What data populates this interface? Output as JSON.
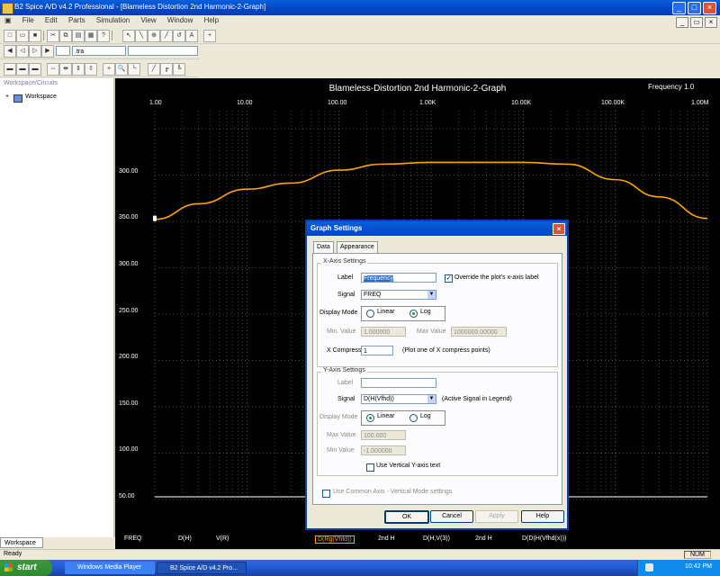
{
  "window": {
    "title": "B2 Spice A/D v4.2 Professional - [Blameless Distortion 2nd Harmonic-2-Graph]"
  },
  "menu": [
    "File",
    "Edit",
    "Parts",
    "Simulation",
    "View",
    "Window",
    "Help"
  ],
  "toolbar2": {
    "field1": "",
    "field2": ".tra",
    "field3": ""
  },
  "sidebar": {
    "title": "Workspace/Circuits",
    "tree_item": "Workspace",
    "tab": "Workspace"
  },
  "graph": {
    "title": "Blameless-Distortion 2nd Harmonic-2-Graph",
    "freq_readout": "Frequency  1.0",
    "x_ticks": [
      "1.00",
      "10.00",
      "100.00",
      "1.00K",
      "10.00K",
      "100.00K",
      "1.00M"
    ],
    "y_ticks": [
      "300.00",
      "350.00",
      "300.00",
      "250.00",
      "200.00",
      "150.00",
      "100.00",
      "50.00",
      "0.0"
    ],
    "legend": [
      "FREQ",
      "D(H)",
      "V(R)",
      "D(Rg(Vhfd))",
      "2nd H",
      "D(H,V(3))",
      "2nd H",
      "D(D(H(Vfhd(x)))"
    ],
    "colors": {
      "curve": "#ffa500",
      "background": "#000000",
      "grid": "#9a9a9a"
    }
  },
  "chart_data": {
    "type": "line",
    "title": "Blameless-Distortion 2nd Harmonic-2-Graph",
    "x_scale": "log",
    "x_range": [
      1,
      1000000
    ],
    "grid": true,
    "series": [
      {
        "x": [
          1,
          3,
          10,
          30,
          100,
          300,
          1000,
          3000,
          10000,
          30000,
          100000,
          300000,
          1000000
        ],
        "y": [
          324,
          342,
          359,
          366,
          381,
          388,
          390,
          390,
          390,
          388,
          370,
          350,
          325
        ]
      },
      {
        "x": [
          1,
          1000000
        ],
        "y": [
          0,
          0
        ]
      }
    ]
  },
  "dialog": {
    "title": "Graph Settings",
    "tabs": [
      "Data",
      "Appearance"
    ],
    "x_axis": {
      "group": "X-Axis Settings",
      "label_lbl": "Label",
      "label_val": "Frequency",
      "override": "Override the plot's x-axis label",
      "signal_lbl": "Signal",
      "signal_val": "FREQ",
      "display_mode_lbl": "Display Mode",
      "linear": "Linear",
      "log": "Log",
      "min_lbl": "Min. Value",
      "min_val": "1.000000",
      "max_lbl": "Max Value",
      "max_val": "1000000.00000",
      "compress_lbl": "X Compress",
      "compress_val": "1",
      "compress_note": "(Plot one of X compress points)"
    },
    "y_axis": {
      "group": "Y-Axis Settings",
      "label_lbl": "Label",
      "label_val": "",
      "signal_lbl": "Signal",
      "signal_val": "D(H(Vfhd))",
      "signal_note": "(Active Signal in Legend)",
      "display_mode_lbl": "Display Mode",
      "linear": "Linear",
      "log": "Log",
      "max_lbl": "Max Value",
      "max_val": "100.000",
      "min_lbl": "Min Value",
      "min_val": "-1.000000",
      "vertical": "Use Vertical Y-axis text"
    },
    "common": "Use Common Axis - Vertical Mode settings",
    "buttons": {
      "ok": "OK",
      "cancel": "Cancel",
      "apply": "Apply",
      "help": "Help"
    }
  },
  "status": {
    "left": "Ready",
    "right": "NUM"
  },
  "taskbar": {
    "start": "start",
    "task1": "Windows Media Player",
    "task2": "B2 Spice A/D v4.2 Pro...",
    "clock": "10:42 PM"
  }
}
